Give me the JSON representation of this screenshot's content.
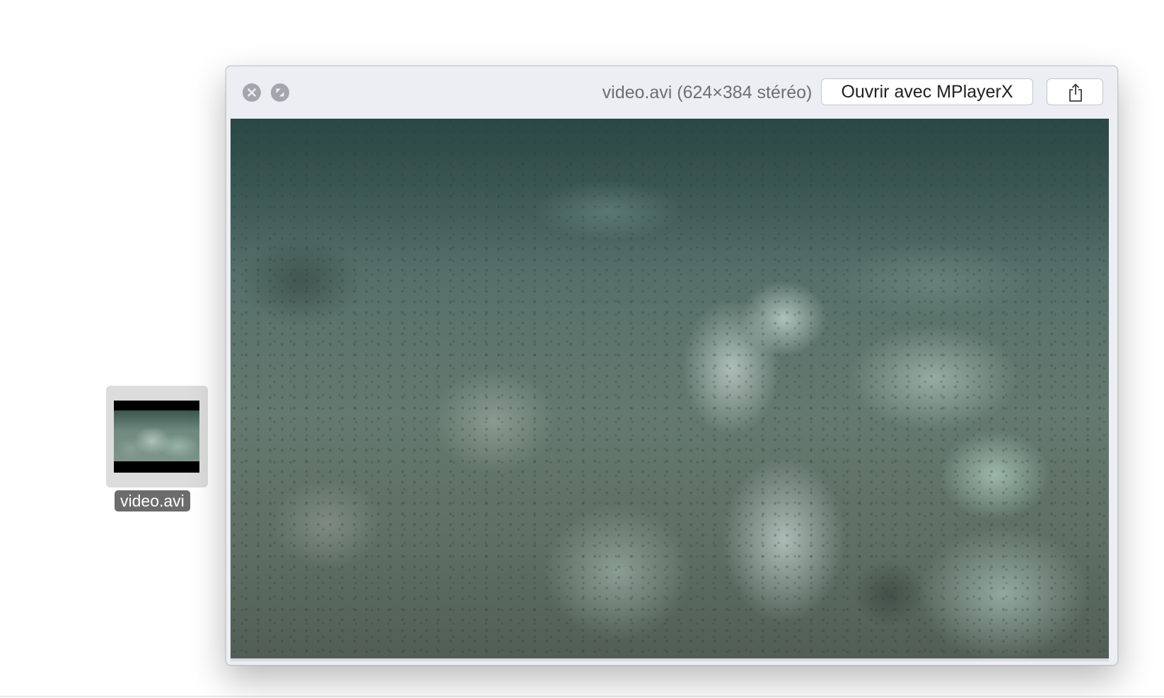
{
  "desktop": {
    "file_icon": {
      "label": "video.avi",
      "icon": "video-thumbnail-icon"
    }
  },
  "quicklook": {
    "title": "video.avi (624×384 stéréo)",
    "buttons": {
      "close_icon": "close-icon",
      "fullscreen_icon": "fullscreen-icon",
      "open_with_label": "Ouvrir avec MPlayerX",
      "share_icon": "share-icon"
    },
    "colors": {
      "titlebar_bg": "#eceef3",
      "title_text": "#6d6f74",
      "control_gray": "#a3a6ac",
      "water_tone": "#5a746d"
    }
  }
}
